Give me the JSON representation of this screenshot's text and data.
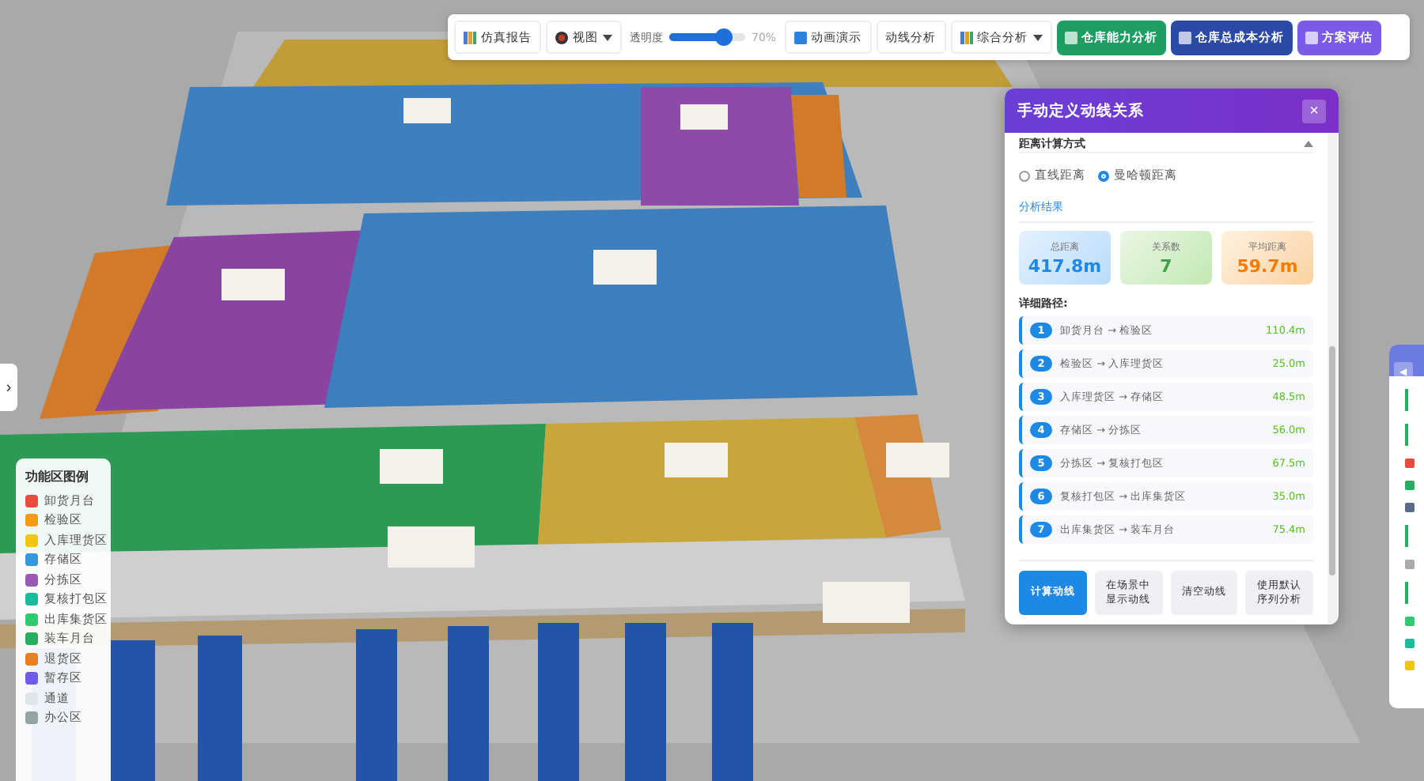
{
  "toolbar": {
    "items": [
      {
        "kind": "button",
        "label": "仿真报告"
      },
      {
        "kind": "dropdown",
        "label": "视图"
      },
      {
        "kind": "slider",
        "label": "透明度",
        "level": 0.72,
        "reading": "70%"
      },
      {
        "kind": "button",
        "label": "动画演示"
      },
      {
        "kind": "button",
        "label": "动线分析"
      },
      {
        "kind": "dropdown",
        "label": "综合分析"
      },
      {
        "kind": "action",
        "label": "仓库能力分析",
        "color": "#1e9e63"
      },
      {
        "kind": "action",
        "label": "仓库总成本分析",
        "color": "#2a4aa8"
      },
      {
        "kind": "action",
        "label": "方案评估",
        "color": "#7a5ae6"
      }
    ]
  },
  "dialog": {
    "title": "手动定义动线关系",
    "close": "×",
    "method_title": "距离计算方式",
    "methods": [
      {
        "label": "直线距离",
        "selected": false
      },
      {
        "label": "曼哈顿距离",
        "selected": true
      }
    ],
    "results_title": "分析结果",
    "stats": [
      {
        "label": "总距离",
        "value": "417.8m",
        "color": "#1e88e5"
      },
      {
        "label": "关系数",
        "value": "7",
        "color": "#43a047"
      },
      {
        "label": "平均距离",
        "value": "59.7m",
        "color": "#f57c00"
      }
    ],
    "paths_title": "详细路径:",
    "paths": [
      {
        "index": "1",
        "route": "卸货月台 → 检验区",
        "distance": "110.4m"
      },
      {
        "index": "2",
        "route": "检验区 → 入库理货区",
        "distance": "25.0m"
      },
      {
        "index": "3",
        "route": "入库理货区 → 存储区",
        "distance": "48.5m"
      },
      {
        "index": "4",
        "route": "存储区 → 分拣区",
        "distance": "56.0m"
      },
      {
        "index": "5",
        "route": "分拣区 → 复核打包区",
        "distance": "67.5m"
      },
      {
        "index": "6",
        "route": "复核打包区 → 出库集货区",
        "distance": "35.0m"
      },
      {
        "index": "7",
        "route": "出库集货区 → 装车月台",
        "distance": "75.4m"
      }
    ],
    "buttons": [
      {
        "label": "计算动线",
        "primary": true
      },
      {
        "label": "在场景中显示动线",
        "primary": false
      },
      {
        "label": "清空动线",
        "primary": false
      },
      {
        "label": "使用默认序列分析",
        "primary": false
      }
    ]
  },
  "legend": {
    "title": "功能区图例",
    "items": [
      {
        "label": "卸货月台",
        "color": "#e74c3c"
      },
      {
        "label": "检验区",
        "color": "#f39c12"
      },
      {
        "label": "入库理货区",
        "color": "#f1c40f"
      },
      {
        "label": "存储区",
        "color": "#3498db"
      },
      {
        "label": "分拣区",
        "color": "#9b59b6"
      },
      {
        "label": "复核打包区",
        "color": "#1abc9c"
      },
      {
        "label": "出库集货区",
        "color": "#2ecc71"
      },
      {
        "label": "装车月台",
        "color": "#27ae60"
      },
      {
        "label": "退货区",
        "color": "#e67e22"
      },
      {
        "label": "暂存区",
        "color": "#6c5ce7"
      },
      {
        "label": "通道",
        "color": "#dfe6e9"
      },
      {
        "label": "办公区",
        "color": "#95a5a6"
      }
    ]
  },
  "side_toggle": "›",
  "right_panel": {
    "toggle": "◀"
  }
}
